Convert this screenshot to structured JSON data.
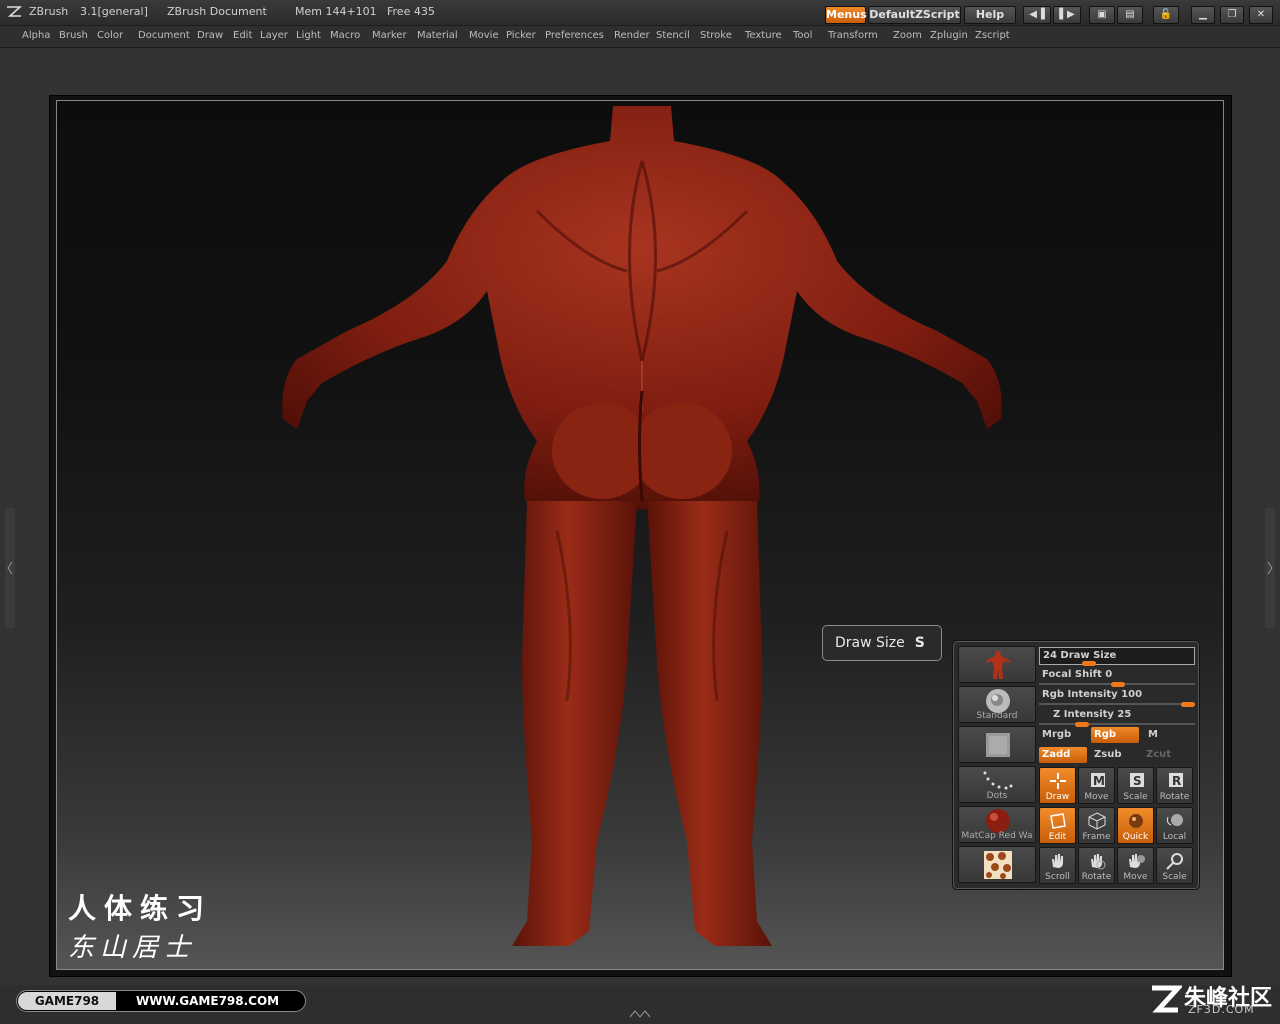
{
  "titlebar": {
    "app_name": "ZBrush",
    "version": "3.1[general]",
    "document": "ZBrush Document",
    "mem": "Mem 144+101",
    "free": "Free 435",
    "menus_label": "Menus",
    "script_label": "DefaultZScript",
    "help_label": "Help"
  },
  "menus": [
    "Alpha",
    "Brush",
    "Color",
    "Document",
    "Draw",
    "Edit",
    "Layer",
    "Light",
    "Macro",
    "Marker",
    "Material",
    "Movie",
    "Picker",
    "Preferences",
    "Render",
    "Stencil",
    "Stroke",
    "Texture",
    "Tool",
    "Transform",
    "Zoom",
    "Zplugin",
    "Zscript"
  ],
  "tooltip": {
    "label": "Draw Size",
    "key": "S"
  },
  "palette": {
    "sliders": [
      {
        "label": "24 Draw Size",
        "value": 24
      },
      {
        "label": "Focal Shift 0",
        "value": 0
      },
      {
        "label": "Rgb Intensity 100",
        "value": 100
      },
      {
        "label": "Z Intensity 25",
        "value": 25
      }
    ],
    "thumbs": {
      "brush": "Standard",
      "stroke": "Dots",
      "material": "MatCap Red Wa"
    },
    "rgb_row": {
      "mrgb": "Mrgb",
      "rgb": "Rgb",
      "m": "M"
    },
    "z_row": {
      "zadd": "Zadd",
      "zsub": "Zsub",
      "zcut": "Zcut"
    },
    "row1": [
      "Draw",
      "Move",
      "Scale",
      "Rotate"
    ],
    "row2": [
      "Edit",
      "Frame",
      "Quick",
      "Local"
    ],
    "row3": [
      "Scroll",
      "Rotate",
      "Move",
      "Scale"
    ]
  },
  "overlay": {
    "title_cn": "人体练习",
    "author_cn": "东山居士",
    "site_tag": "GAME798",
    "site_url": "WWW.GAME798.COM",
    "brand_cn": "朱峰社区",
    "brand_en": "ZF3D.COM"
  },
  "colors": {
    "accent": "#f07818",
    "model": "#8a1f12"
  }
}
